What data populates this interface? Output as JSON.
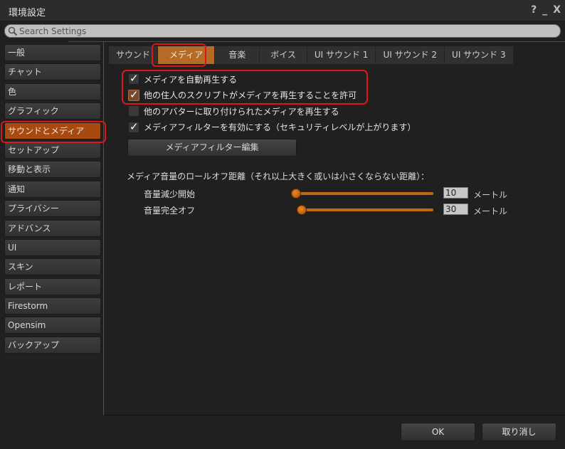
{
  "window": {
    "title": "環境設定",
    "controls": {
      "help": "?",
      "minimize": "_",
      "close": "X"
    }
  },
  "search": {
    "placeholder": "Search Settings",
    "value": ""
  },
  "sidebar": {
    "selected": "サウンドとメディア",
    "items": [
      {
        "label": "一般"
      },
      {
        "label": "チャット"
      },
      {
        "label": "色"
      },
      {
        "label": "グラフィック"
      },
      {
        "label": "サウンドとメディア"
      },
      {
        "label": "セットアップ"
      },
      {
        "label": "移動と表示"
      },
      {
        "label": "通知"
      },
      {
        "label": "プライバシー"
      },
      {
        "label": "アドバンス"
      },
      {
        "label": "UI"
      },
      {
        "label": "スキン"
      },
      {
        "label": "レポート"
      },
      {
        "label": "Firestorm"
      },
      {
        "label": "Opensim"
      },
      {
        "label": "バックアップ"
      }
    ]
  },
  "tabs": {
    "selected": "メディア",
    "items": [
      {
        "label": "サウンド"
      },
      {
        "label": "メディア"
      },
      {
        "label": "音楽"
      },
      {
        "label": "ボイス"
      },
      {
        "label": "UI サウンド 1"
      },
      {
        "label": "UI サウンド 2"
      },
      {
        "label": "UI サウンド 3"
      }
    ]
  },
  "media": {
    "checkboxes": [
      {
        "label": "メディアを自動再生する",
        "checked": true
      },
      {
        "label": "他の住人のスクリプトがメディアを再生することを許可",
        "checked": true
      },
      {
        "label": "他のアバターに取り付けられたメディアを再生する",
        "checked": false
      },
      {
        "label": "メディアフィルターを有効にする（セキュリティレベルが上がります）",
        "checked": true
      }
    ],
    "filter_edit_button": "メディアフィルター編集",
    "rolloff_label": "メディア音量のロールオフ距離（それ以上大きく或いは小さくならない距離）：",
    "sliders": [
      {
        "label": "音量減少開始",
        "value": "10",
        "unit": "メートル"
      },
      {
        "label": "音量完全オフ",
        "value": "30",
        "unit": "メートル"
      }
    ]
  },
  "footer": {
    "ok": "OK",
    "cancel": "取り消し"
  },
  "annotations": {
    "highlight_color": "#e0151b"
  },
  "colors": {
    "accent_sidebar": "#a84a10",
    "accent_tab": "#b56a26",
    "slider": "#c06a10"
  }
}
